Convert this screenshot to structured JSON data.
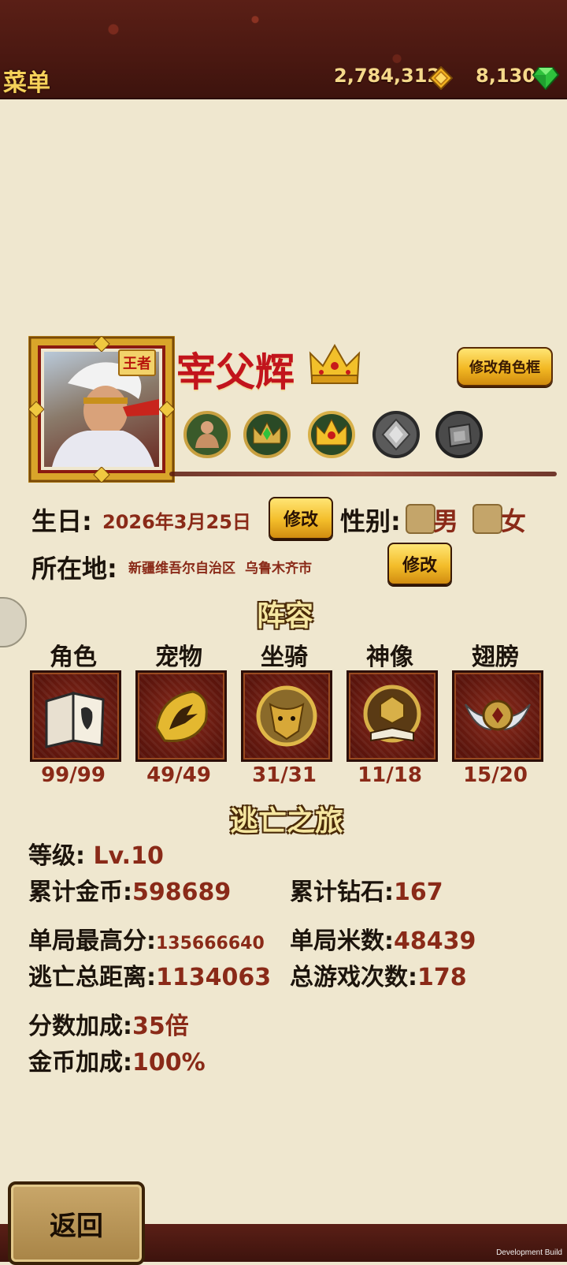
{
  "header": {
    "menu_label": "菜单",
    "coins": "2,784,312",
    "gems": "8,130"
  },
  "profile": {
    "rank_badge": "王者",
    "name": "宰父辉",
    "edit_frame_label": "修改角色框",
    "birthday_label": "生日:",
    "birthday_value": "2026年3月25日",
    "edit_label": "修改",
    "gender_label": "性别:",
    "gender_male": "男",
    "gender_female": "女",
    "location_label": "所在地:",
    "location_region": "新疆维吾尔自治区",
    "location_city": "乌鲁木齐市"
  },
  "lineup": {
    "title": "阵容",
    "items": [
      {
        "label": "角色",
        "count": "99/99"
      },
      {
        "label": "宠物",
        "count": "49/49"
      },
      {
        "label": "坐骑",
        "count": "31/31"
      },
      {
        "label": "神像",
        "count": "11/18"
      },
      {
        "label": "翅膀",
        "count": "15/20"
      }
    ]
  },
  "journey": {
    "title": "逃亡之旅",
    "level_label": "等级:",
    "level_value": "Lv.10",
    "total_coins_label": "累计金币:",
    "total_coins_value": "598689",
    "total_gems_label": "累计钻石:",
    "total_gems_value": "167",
    "best_score_label": "单局最高分:",
    "best_score_value": "135666640",
    "best_meters_label": "单局米数:",
    "best_meters_value": "48439",
    "total_distance_label": "逃亡总距离:",
    "total_distance_value": "1134063",
    "total_games_label": "总游戏次数:",
    "total_games_value": "178",
    "score_bonus_label": "分数加成:",
    "score_bonus_value": "35倍",
    "coin_bonus_label": "金币加成:",
    "coin_bonus_value": "100%"
  },
  "footer": {
    "back_label": "返回",
    "dev_build": "Development Build"
  }
}
